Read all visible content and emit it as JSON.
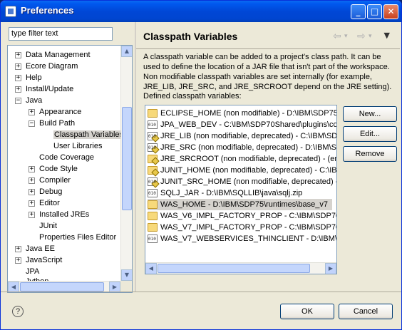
{
  "window": {
    "title": "Preferences"
  },
  "titlebar": {
    "minimize": "_",
    "maximize": "□",
    "close": "✕"
  },
  "filter": {
    "value": "type filter text"
  },
  "tree": [
    {
      "label": "Data Management",
      "expander": "+"
    },
    {
      "label": "Ecore Diagram",
      "expander": "+"
    },
    {
      "label": "Help",
      "expander": "+"
    },
    {
      "label": "Install/Update",
      "expander": "+"
    },
    {
      "label": "Java",
      "expander": "−"
    },
    {
      "label": "Appearance",
      "expander": "+"
    },
    {
      "label": "Build Path",
      "expander": "−"
    },
    {
      "label": "Classpath Variables",
      "expander": ""
    },
    {
      "label": "User Libraries",
      "expander": ""
    },
    {
      "label": "Code Coverage",
      "expander": ""
    },
    {
      "label": "Code Style",
      "expander": "+"
    },
    {
      "label": "Compiler",
      "expander": "+"
    },
    {
      "label": "Debug",
      "expander": "+"
    },
    {
      "label": "Editor",
      "expander": "+"
    },
    {
      "label": "Installed JREs",
      "expander": "+"
    },
    {
      "label": "JUnit",
      "expander": ""
    },
    {
      "label": "Properties Files Editor",
      "expander": ""
    },
    {
      "label": "Java EE",
      "expander": "+"
    },
    {
      "label": "JavaScript",
      "expander": "+"
    },
    {
      "label": "JPA",
      "expander": ""
    },
    {
      "label": "Jython",
      "expander": ""
    }
  ],
  "page": {
    "title": "Classpath Variables",
    "description": "A classpath variable can be added to a project's class path. It can be used to define the location of a JAR file that isn't part of the workspace. Non modifiable classpath variables are set internally (for example, JRE_LIB, JRE_SRC, and JRE_SRCROOT depend on the JRE setting).",
    "list_label": "Defined classpath variables:"
  },
  "variables": [
    {
      "text": "ECLIPSE_HOME (non modifiable) - D:\\IBM\\SDP75",
      "icon": "folder-icon"
    },
    {
      "text": "JPA_WEB_DEV - C:\\IBM\\SDP70Shared\\plugins\\com.",
      "icon": "jar-icon"
    },
    {
      "text": "JRE_LIB (non modifiable, deprecated) - C:\\IBM\\SDP",
      "icon": "jar-warning-icon"
    },
    {
      "text": "JRE_SRC (non modifiable, deprecated) - D:\\IBM\\SDP",
      "icon": "jar-warning-icon"
    },
    {
      "text": "JRE_SRCROOT (non modifiable, deprecated) - (emp",
      "icon": "folder-warning-icon"
    },
    {
      "text": "JUNIT_HOME (non modifiable, deprecated) - C:\\IBM",
      "icon": "folder-warning-icon"
    },
    {
      "text": "JUNIT_SRC_HOME (non modifiable, deprecated) - C:\\",
      "icon": "jar-warning-icon"
    },
    {
      "text": "SQLJ_JAR - D:\\IBM\\SQLLIB\\java\\sqlj.zip",
      "icon": "jar-icon"
    },
    {
      "text": "WAS_HOME - D:\\IBM\\SDP75\\runtimes\\base_v7",
      "icon": "folder-icon"
    },
    {
      "text": "WAS_V6_IMPL_FACTORY_PROP - C:\\IBM\\SDP70Sha",
      "icon": "folder-icon"
    },
    {
      "text": "WAS_V7_IMPL_FACTORY_PROP - C:\\IBM\\SDP70Sha",
      "icon": "folder-icon"
    },
    {
      "text": "WAS_V7_WEBSERVICES_THINCLIENT - D:\\IBM\\SDP",
      "icon": "jar-icon"
    }
  ],
  "buttons": {
    "new": "New...",
    "edit": "Edit...",
    "remove": "Remove",
    "ok": "OK",
    "cancel": "Cancel",
    "help": "?"
  },
  "nav": {
    "back": "⇦",
    "forward": "⇨",
    "dropdown": "▾",
    "menu": "▼"
  }
}
